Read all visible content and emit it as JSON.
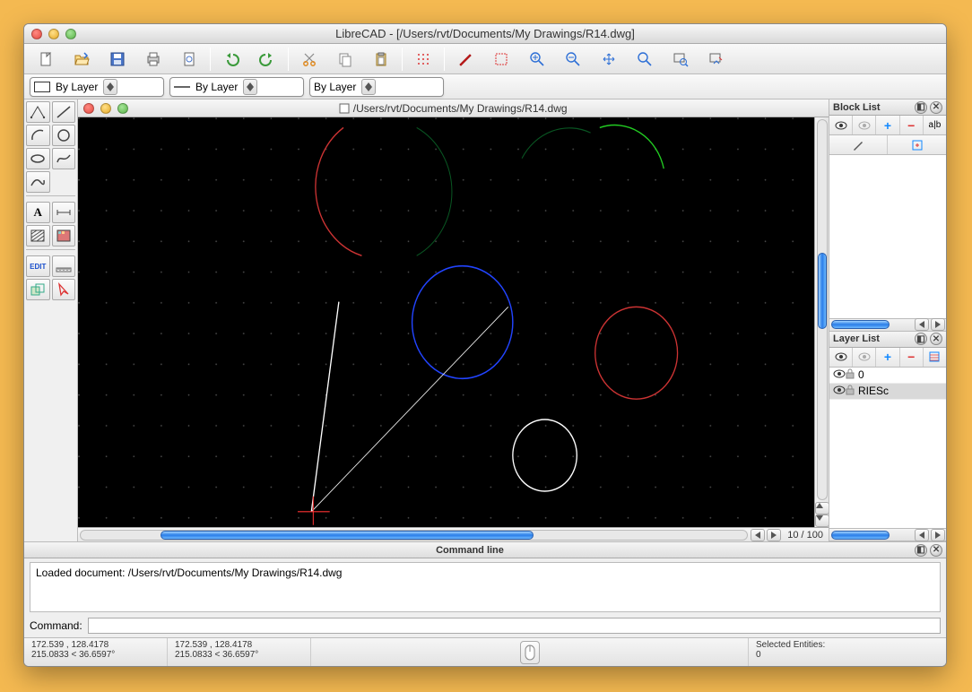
{
  "window": {
    "title": "LibreCAD - [/Users/rvt/Documents/My Drawings/R14.dwg]"
  },
  "document": {
    "title": "/Users/rvt/Documents/My Drawings/R14.dwg"
  },
  "layerbar": {
    "color_label": "By Layer",
    "width_label": "By Layer",
    "linetype_label": "By Layer"
  },
  "scroll": {
    "info": "10 / 100"
  },
  "panels": {
    "block_list": {
      "title": "Block List"
    },
    "layer_list": {
      "title": "Layer List",
      "layers": [
        {
          "name": "0",
          "visible": true,
          "locked": true,
          "selected": false
        },
        {
          "name": "RIESc",
          "visible": true,
          "locked": true,
          "selected": true
        }
      ]
    }
  },
  "command_line": {
    "title": "Command line",
    "log": "Loaded document: /Users/rvt/Documents/My Drawings/R14.dwg",
    "prompt": "Command:"
  },
  "status": {
    "abs1": "172.539 , 128.4178",
    "rel1": "215.0833 < 36.6597°",
    "abs2": "172.539 , 128.4178",
    "rel2": "215.0833 < 36.6597°",
    "sel_label": "Selected Entities:",
    "sel_count": "0"
  }
}
